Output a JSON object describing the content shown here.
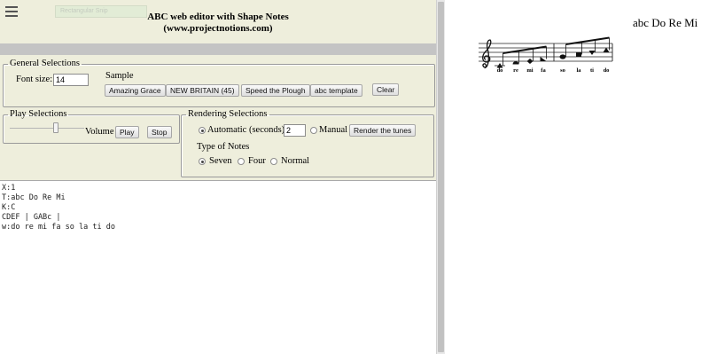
{
  "app": {
    "title_line1": "ABC web editor with Shape Notes",
    "title_line2": "(www.projectnotions.com)",
    "menu_icon": "hamburger-menu-icon",
    "ghost_tooltip": "Rectangular Snip"
  },
  "general": {
    "legend": "General Selections",
    "font_size_label": "Font size:",
    "font_size_value": "14",
    "sample_label": "Sample",
    "sample_buttons": [
      "Amazing Grace",
      "NEW BRITAIN (45)",
      "Speed the Plough",
      "abc template"
    ],
    "clear_button": "Clear"
  },
  "play": {
    "legend": "Play Selections",
    "volume_label": "Volume",
    "volume_level": 0.62,
    "play_button": "Play",
    "stop_button": "Stop"
  },
  "rendering": {
    "legend": "Rendering Selections",
    "automatic_label": "Automatic (seconds)",
    "automatic_seconds": "2",
    "manual_label": "Manual",
    "render_button": "Render the tunes",
    "selected_mode": "automatic",
    "note_type_label": "Type of Notes",
    "note_types": [
      "Seven",
      "Four",
      "Normal"
    ],
    "selected_note_type": "Seven"
  },
  "editor": {
    "lines": [
      "X:1",
      "T:abc Do Re Mi",
      "K:C",
      "CDEF | GABc |",
      "w:do re mi fa so la ti do"
    ]
  },
  "score": {
    "title": "abc Do Re Mi",
    "clef": "treble",
    "notes": [
      "C",
      "D",
      "E",
      "F",
      "G",
      "A",
      "B",
      "c"
    ],
    "syllables": [
      "do",
      "re",
      "mi",
      "fa",
      "so",
      "la",
      "ti",
      "do"
    ],
    "note_shapes": [
      "triangle",
      "half-moon",
      "diamond",
      "right-triangle",
      "oval",
      "square",
      "cone",
      "triangle"
    ]
  }
}
